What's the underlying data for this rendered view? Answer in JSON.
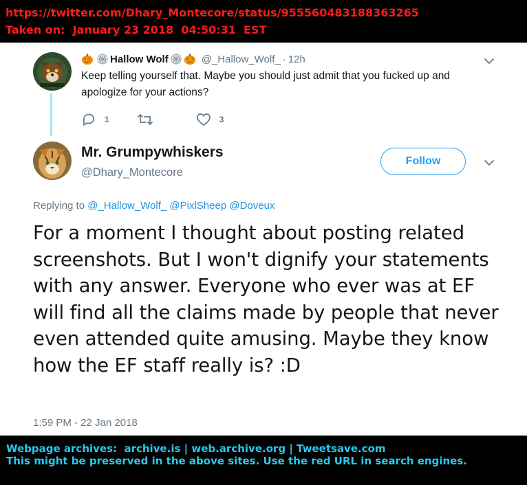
{
  "banner_top": {
    "url": "https://twitter.com/Dhary_Montecore/status/955560483188363265",
    "taken_on": "Taken on:  January 23 2018  04:50:31  EST",
    "color": "#ff1a1a"
  },
  "parent_tweet": {
    "display_name": "Hallow Wolf",
    "handle": "@_Hallow_Wolf_",
    "separator": "·",
    "time": "12h",
    "text": "Keep telling yourself that. Maybe you should just admit that you fucked up and apologize for your actions?",
    "reply_count": "1",
    "retweet_count": "",
    "like_count": "3",
    "name_decorations": [
      "jack-o-lantern-icon",
      "spider-web-icon",
      "spider-web-icon",
      "jack-o-lantern-icon"
    ]
  },
  "main_tweet": {
    "display_name": "Mr. Grumpywhiskers",
    "handle": "@Dhary_Montecore",
    "follow_label": "Follow",
    "replying_prefix": "Replying to",
    "mentions": [
      "@_Hallow_Wolf_",
      "@PixlSheep",
      "@Doveux"
    ],
    "text": "For a moment I thought about posting related screenshots. But I won't dignify your statements with any answer. Everyone who ever was at EF will find all the claims made by people that never even attended quite amusing. Maybe they know how the EF staff really is? :D",
    "timestamp": "1:59 PM - 22 Jan 2018"
  },
  "banner_bottom": {
    "line1": "Webpage archives:  archive.is | web.archive.org | Tweetsave.com",
    "line2": "This might be preserved in the above sites. Use the red URL in search engines.",
    "color": "#29c8ef"
  },
  "colors": {
    "accent": "#1da1f2",
    "link": "#1b95e0",
    "muted": "#657786",
    "thread_line": "#a6e3e9"
  }
}
